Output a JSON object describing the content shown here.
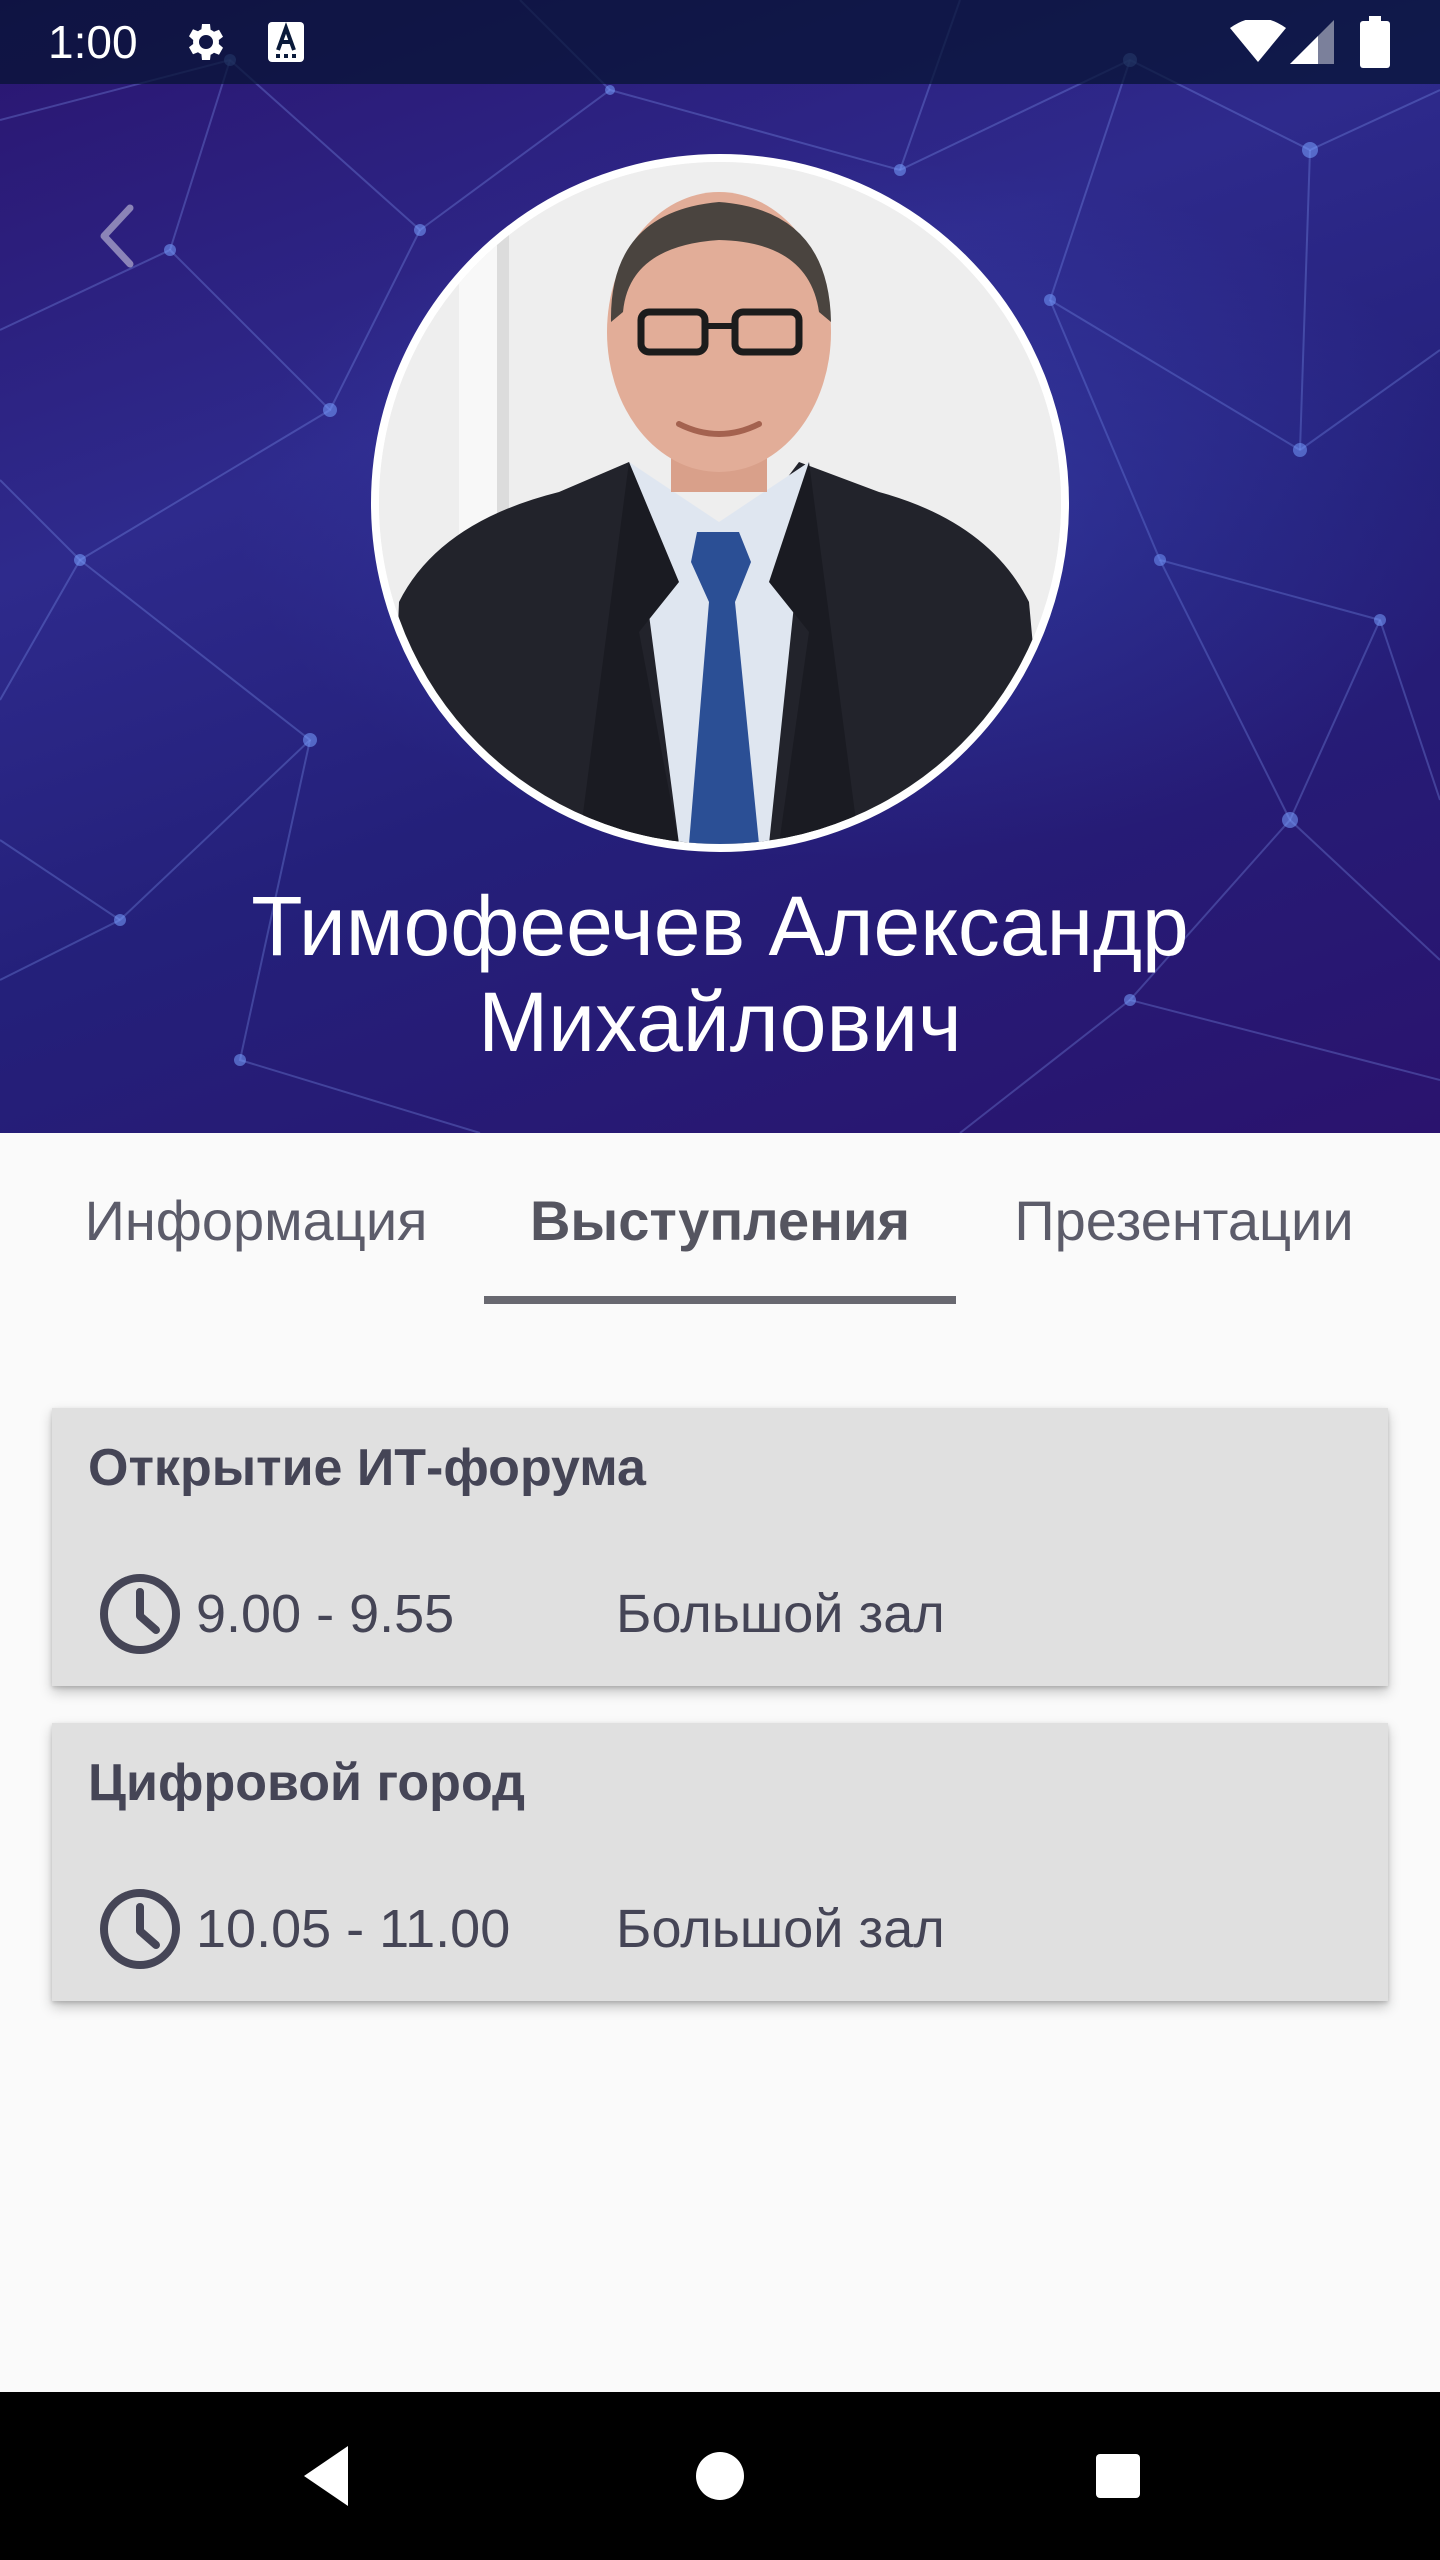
{
  "status_bar": {
    "time": "1:00",
    "icons": [
      "gear-icon",
      "accessibility-a-icon",
      "wifi-icon",
      "signal-icon",
      "battery-icon"
    ]
  },
  "header": {
    "back_icon": "chevron-left-icon",
    "speaker_name": "Тимофеечев Александр Михайлович",
    "avatar": "speaker-photo"
  },
  "tabs": [
    {
      "label": "Информация",
      "selected": false
    },
    {
      "label": "Выступления",
      "selected": true
    },
    {
      "label": "Презентации",
      "selected": false
    }
  ],
  "talks": [
    {
      "title": "Открытие ИТ-форума",
      "time": "9.00 - 9.55",
      "room": "Большой зал",
      "icon": "clock-icon"
    },
    {
      "title": "Цифровой город",
      "time": "10.05 - 11.00",
      "room": "Большой зал",
      "icon": "clock-icon"
    }
  ],
  "nav_bar": {
    "icons": [
      "nav-back-icon",
      "nav-home-icon",
      "nav-recents-icon"
    ]
  },
  "colors": {
    "hero_background": "#2a1a7a",
    "card_background": "#e0e0e0",
    "text_dark": "#454556",
    "tab_indicator": "#686870"
  }
}
